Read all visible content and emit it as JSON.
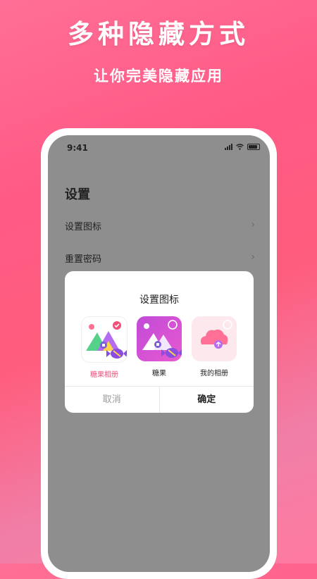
{
  "promo": {
    "headline": "多种隐藏方式",
    "subline": "让你完美隐藏应用"
  },
  "status_bar": {
    "time": "9:41"
  },
  "settings": {
    "title": "设置",
    "rows": [
      {
        "label": "设置图标"
      },
      {
        "label": "重置密码"
      }
    ]
  },
  "dialog": {
    "title": "设置图标",
    "options": [
      {
        "label": "糖果相册",
        "icon": "candy-album-icon",
        "selected": true
      },
      {
        "label": "糖果",
        "icon": "candy-icon",
        "selected": false
      },
      {
        "label": "我的相册",
        "icon": "cloud-album-icon",
        "selected": false
      }
    ],
    "cancel_label": "取消",
    "confirm_label": "确定"
  },
  "colors": {
    "accent": "#f0507a",
    "background": "#ff5a86",
    "overlay": "#8e8e8e"
  }
}
